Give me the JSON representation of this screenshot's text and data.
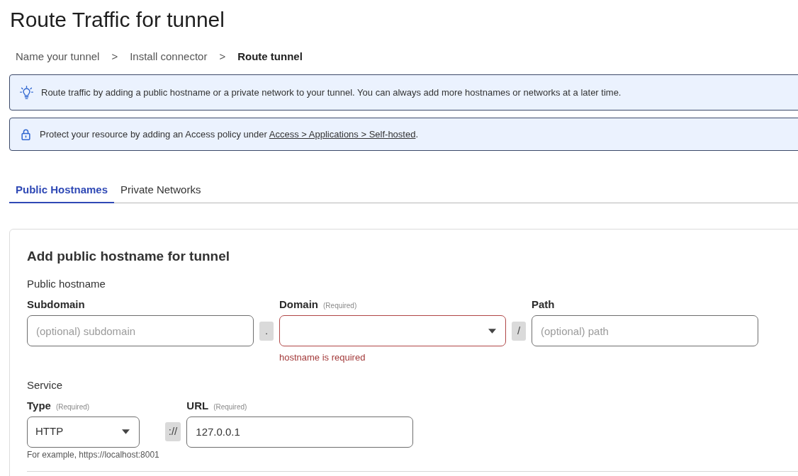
{
  "page_title": "Route Traffic for tunnel",
  "breadcrumb": [
    {
      "kind": "step",
      "label": "Name your tunnel",
      "current": false
    },
    {
      "kind": "separator",
      "label": ">"
    },
    {
      "kind": "step",
      "label": "Install connector",
      "current": false
    },
    {
      "kind": "separator",
      "label": ">"
    },
    {
      "kind": "step",
      "label": "Route tunnel",
      "current": true
    }
  ],
  "notices": [
    {
      "kind": "tip",
      "text": "Route traffic by adding a public hostname or a private network to your tunnel. You can always add more hostnames or networks at a later time."
    },
    {
      "kind": "security",
      "text": "Protect your resource by adding an Access policy under ",
      "link": "Access > Applications > Self-hosted",
      "text_after": "."
    }
  ],
  "tabs": [
    {
      "label": "Public Hostnames",
      "selected": true
    },
    {
      "label": "Private Networks",
      "selected": false
    }
  ],
  "form": {
    "title": "Add public hostname for tunnel",
    "sections": [
      {
        "label": "Public hostname",
        "fields": [
          {
            "kind": "text",
            "label": "Subdomain",
            "placeholder": "(optional) subdomain",
            "invalid": false
          },
          {
            "kind": "joiner",
            "text": "."
          },
          {
            "kind": "select",
            "label": "Domain",
            "note": "(Required)",
            "invalid": true,
            "error": "hostname is required"
          },
          {
            "kind": "joiner",
            "text": "/"
          },
          {
            "kind": "text",
            "label": "Path",
            "placeholder": "(optional) path",
            "invalid": false
          }
        ]
      },
      {
        "label": "Service",
        "fields": [
          {
            "kind": "select",
            "label": "Type",
            "note": "(Required)",
            "value": "HTTP",
            "invalid": false,
            "help": "For example, https://localhost:8001"
          },
          {
            "kind": "joiner",
            "text": "://"
          },
          {
            "kind": "text",
            "label": "URL",
            "note": "(Required)",
            "value": "127.0.0.1",
            "invalid": false
          }
        ]
      }
    ]
  }
}
